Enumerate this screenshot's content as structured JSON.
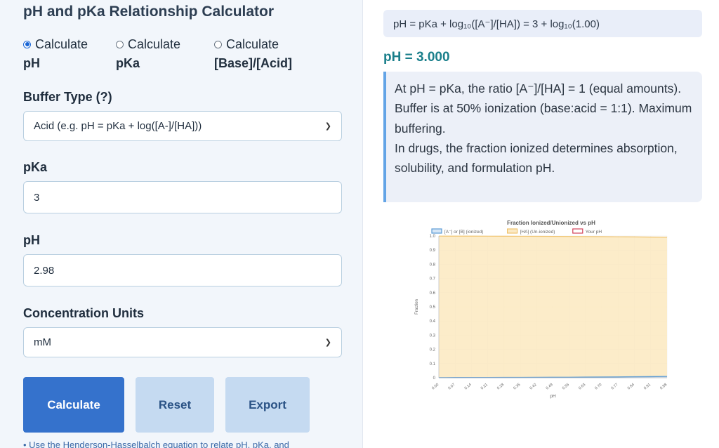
{
  "title": "pH and pKa Relationship Calculator",
  "modes": [
    {
      "prefix": "Calculate",
      "label": "pH",
      "selected": true
    },
    {
      "prefix": "Calculate",
      "label": "pKa",
      "selected": false
    },
    {
      "prefix": "Calculate",
      "label": "[Base]/[Acid]",
      "selected": false
    }
  ],
  "buffer_type": {
    "label": "Buffer Type (?)",
    "value": "Acid (e.g. pH = pKa + log([A-]/[HA]))"
  },
  "pka": {
    "label": "pKa",
    "value": "3"
  },
  "ph": {
    "label": "pH",
    "value": "2.98"
  },
  "units": {
    "label": "Concentration Units",
    "value": "mM"
  },
  "buttons": {
    "calculate": "Calculate",
    "reset": "Reset",
    "export": "Export"
  },
  "hint": "• Use the Henderson-Hasselbalch equation to relate pH, pKa, and",
  "formula": "pH = pKa + log₁₀([A⁻]/[HA]) = 3 + log₁₀(1.00)",
  "result": "pH = 3.000",
  "explanation": [
    "At pH = pKa, the ratio [A⁻]/[HA] = 1 (equal amounts).",
    "Buffer is at 50% ionization (base:acid = 1:1). Maximum buffering.",
    "In drugs, the fraction ionized determines absorption, solubility, and formulation pH."
  ],
  "colors": {
    "accent": "#3572cc",
    "result": "#1a7f8b",
    "ionized": "#5b9bd5",
    "unionized": "#f0c36d",
    "your_ph": "#d1435b"
  },
  "chart_data": {
    "type": "area",
    "title": "Fraction Ionized/Unionized vs pH",
    "xlabel": "pH",
    "ylabel": "Fraction",
    "x": [
      "0.00",
      "0.07",
      "0.14",
      "0.21",
      "0.28",
      "0.35",
      "0.42",
      "0.49",
      "0.56",
      "0.63",
      "0.70",
      "0.77",
      "0.84",
      "0.91",
      "0.98"
    ],
    "ylim": [
      0,
      1.0
    ],
    "yticks": [
      "0",
      "0.1",
      "0.2",
      "0.3",
      "0.4",
      "0.5",
      "0.6",
      "0.7",
      "0.8",
      "0.9",
      "1.0"
    ],
    "legend_position": "top",
    "series": [
      {
        "name": "[A⁻] or [B] (ionized)",
        "values": [
          0.001,
          0.0012,
          0.0014,
          0.0016,
          0.0019,
          0.0022,
          0.0026,
          0.0031,
          0.0036,
          0.0043,
          0.005,
          0.0059,
          0.0069,
          0.0081,
          0.0095
        ]
      },
      {
        "name": "[HA] (Un-ionized)",
        "values": [
          0.999,
          0.9988,
          0.9986,
          0.9984,
          0.9981,
          0.9978,
          0.9974,
          0.9969,
          0.9964,
          0.9957,
          0.995,
          0.9941,
          0.9931,
          0.9919,
          0.9905
        ]
      },
      {
        "name": "Your pH",
        "values": []
      }
    ],
    "grid": true
  }
}
